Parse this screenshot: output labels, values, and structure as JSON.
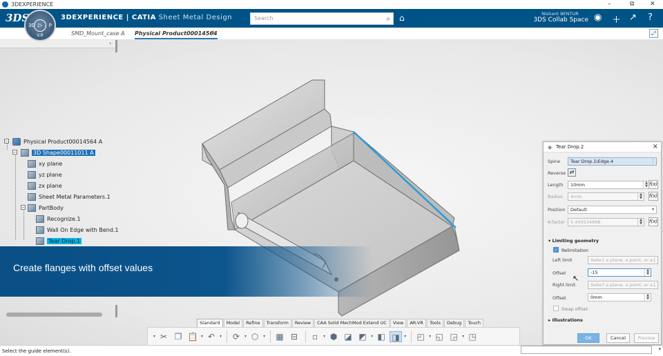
{
  "window": {
    "title": "3DEXPERIENCE",
    "controls": {
      "minimize": "–",
      "restore": "⧉",
      "close": "✕"
    }
  },
  "topbar": {
    "logo": "3DS",
    "compass": {
      "left": "3D",
      "right": "P",
      "version": "V.R"
    },
    "brand": "3DEXPERIENCE | CATIA",
    "module": "Sheet Metal Design",
    "search_placeholder": "Search",
    "user_name": "Nishant BENTUR",
    "space": "3DS Collab Space",
    "bg": "#005386"
  },
  "tabs": [
    {
      "label": "SMD_Mount_case A"
    },
    {
      "label": "Physical Product00014564"
    }
  ],
  "tree": {
    "root": "Physical Product00014564 A",
    "shape": "3D Shape00011011 A",
    "items": [
      "xy plane",
      "yz plane",
      "zx plane",
      "Sheet Metal Parameters.1",
      "PartBody",
      "Recognize.1",
      "Wall On Edge with Bend.1",
      "Tear Drop.1"
    ]
  },
  "banner": {
    "text": "Create flanges with offset values"
  },
  "toolbar_tabs": [
    "Standard",
    "Model",
    "Refine",
    "Transform",
    "Review",
    "CAA Solid MechMod Extend UC",
    "View",
    "AR-VR",
    "Tools",
    "Debug",
    "Touch"
  ],
  "status": {
    "message": "Select the guide element(s)."
  },
  "panel": {
    "title": "Tear Drop.2",
    "spine_label": "Spine",
    "spine_value": "Tear Drop.1\\Edge.4",
    "reverse_label": "Reverse",
    "length_label": "Length",
    "length_value": "10mm",
    "radius_label": "Radius",
    "radius_value": "4mm",
    "position_label": "Position",
    "position_value": "Default",
    "kfactor_label": "K-factor",
    "kfactor_value": "0.400534998",
    "limiting_label": "Limiting geometry",
    "relimitation_label": "Relimitation",
    "left_limit_label": "Left limit",
    "left_limit_placeholder": "Select a plane, a point, or a...",
    "offset1_label": "Offset",
    "offset1_value": "-15",
    "right_limit_label": "Right limit",
    "right_limit_placeholder": "Select a plane, a point, or a...",
    "offset2_label": "Offset",
    "offset2_value": "0mm",
    "swap_label": "Swap offset",
    "illustrations_label": "Illustrations",
    "ok": "OK",
    "cancel": "Cancel",
    "preview": "Preview",
    "fx": "f(x)"
  },
  "colors": {
    "accent": "#005386",
    "highlight": "#00b4e6",
    "banner": "#0c548c"
  }
}
